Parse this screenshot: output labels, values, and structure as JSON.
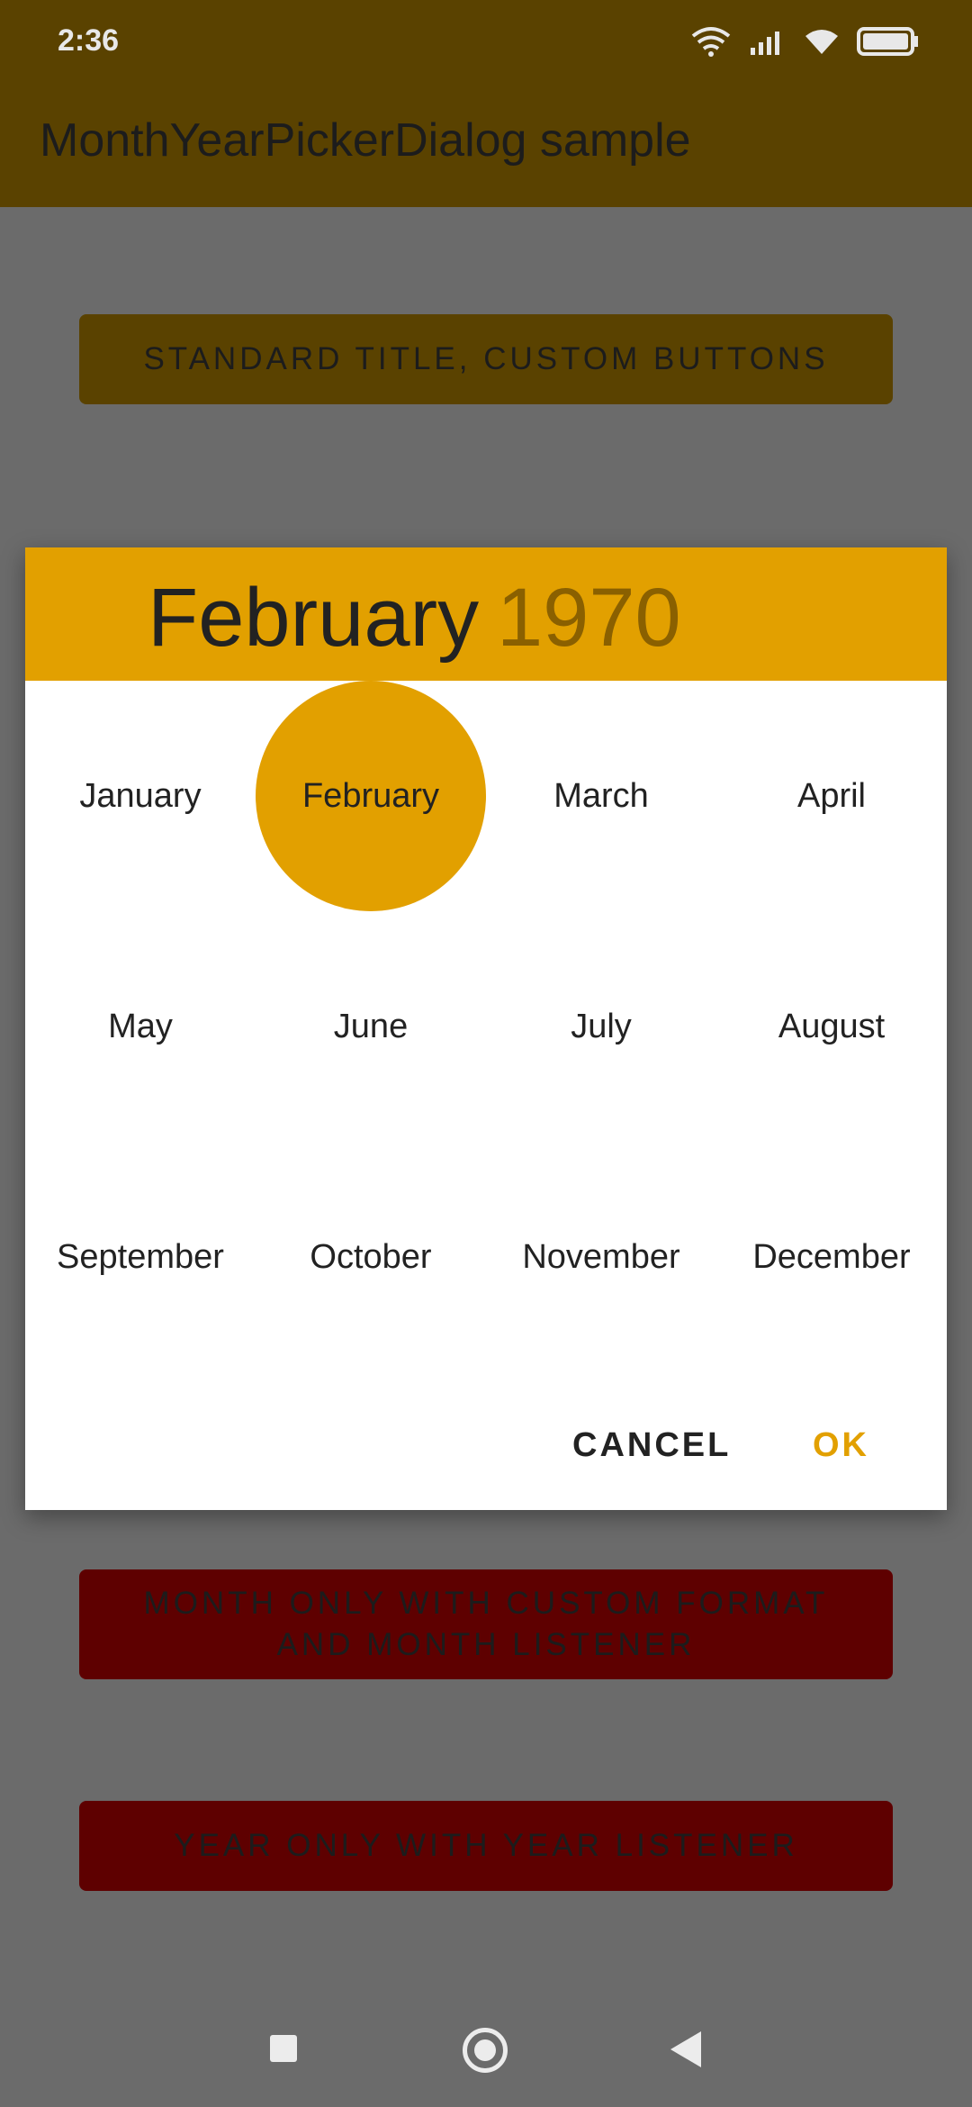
{
  "status_bar": {
    "time": "2:36",
    "icons": [
      "wifi-calling-icon",
      "signal-icon",
      "wifi-icon",
      "battery-icon"
    ]
  },
  "app_bar": {
    "title": "MonthYearPickerDialog sample"
  },
  "background_buttons": {
    "standard": "STANDARD TITLE, CUSTOM BUTTONS",
    "month_only_line1": "MONTH ONLY WITH CUSTOM FORMAT",
    "month_only_line2": "AND MONTH LISTENER",
    "year_only": "YEAR ONLY WITH YEAR LISTENER"
  },
  "dialog": {
    "header_month": "February",
    "header_year": "1970",
    "months": [
      "January",
      "February",
      "March",
      "April",
      "May",
      "June",
      "July",
      "August",
      "September",
      "October",
      "November",
      "December"
    ],
    "selected_month": "February",
    "cancel_label": "CANCEL",
    "ok_label": "OK"
  },
  "colors": {
    "accent": "#e2a000",
    "dim_overlay": "#6b6b6b"
  }
}
